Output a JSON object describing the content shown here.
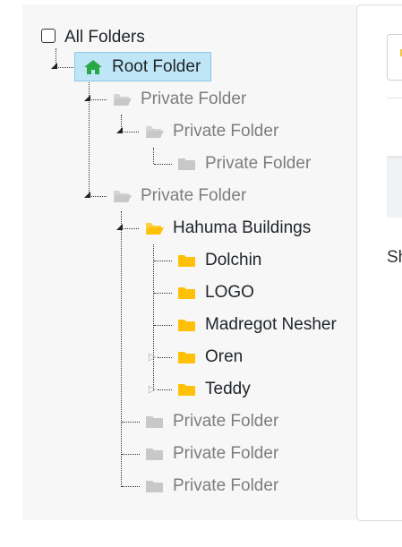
{
  "tree": {
    "all_folders_label": "All Folders",
    "root": {
      "label": "Root Folder",
      "icon": "home-icon",
      "icon_color": "#28a745"
    },
    "nodes": [
      {
        "label": "Private Folder",
        "icon": "folder-open-icon",
        "color": "#c8c8c8",
        "text_style": "gray"
      },
      {
        "label": "Private Folder",
        "icon": "folder-open-icon",
        "color": "#c8c8c8",
        "text_style": "gray"
      },
      {
        "label": "Private Folder",
        "icon": "folder-icon",
        "color": "#c8c8c8",
        "text_style": "gray"
      },
      {
        "label": "Private Folder",
        "icon": "folder-open-icon",
        "color": "#c8c8c8",
        "text_style": "gray"
      },
      {
        "label": "Hahuma Buildings",
        "icon": "folder-open-icon",
        "color": "#ffc107",
        "text_style": "dark"
      },
      {
        "label": "Dolchin",
        "icon": "folder-icon",
        "color": "#ffc107",
        "text_style": "dark"
      },
      {
        "label": "LOGO",
        "icon": "folder-icon",
        "color": "#ffc107",
        "text_style": "dark"
      },
      {
        "label": "Madregot Nesher",
        "icon": "folder-icon",
        "color": "#ffc107",
        "text_style": "dark"
      },
      {
        "label": "Oren",
        "icon": "folder-icon",
        "color": "#ffc107",
        "text_style": "dark"
      },
      {
        "label": "Teddy",
        "icon": "folder-icon",
        "color": "#ffc107",
        "text_style": "dark"
      },
      {
        "label": "Private Folder",
        "icon": "folder-icon",
        "color": "#c8c8c8",
        "text_style": "gray"
      },
      {
        "label": "Private Folder",
        "icon": "folder-icon",
        "color": "#c8c8c8",
        "text_style": "gray"
      },
      {
        "label": "Private Folder",
        "icon": "folder-icon",
        "color": "#c8c8c8",
        "text_style": "gray"
      }
    ]
  },
  "right_panel": {
    "partial_text": "Sh"
  }
}
